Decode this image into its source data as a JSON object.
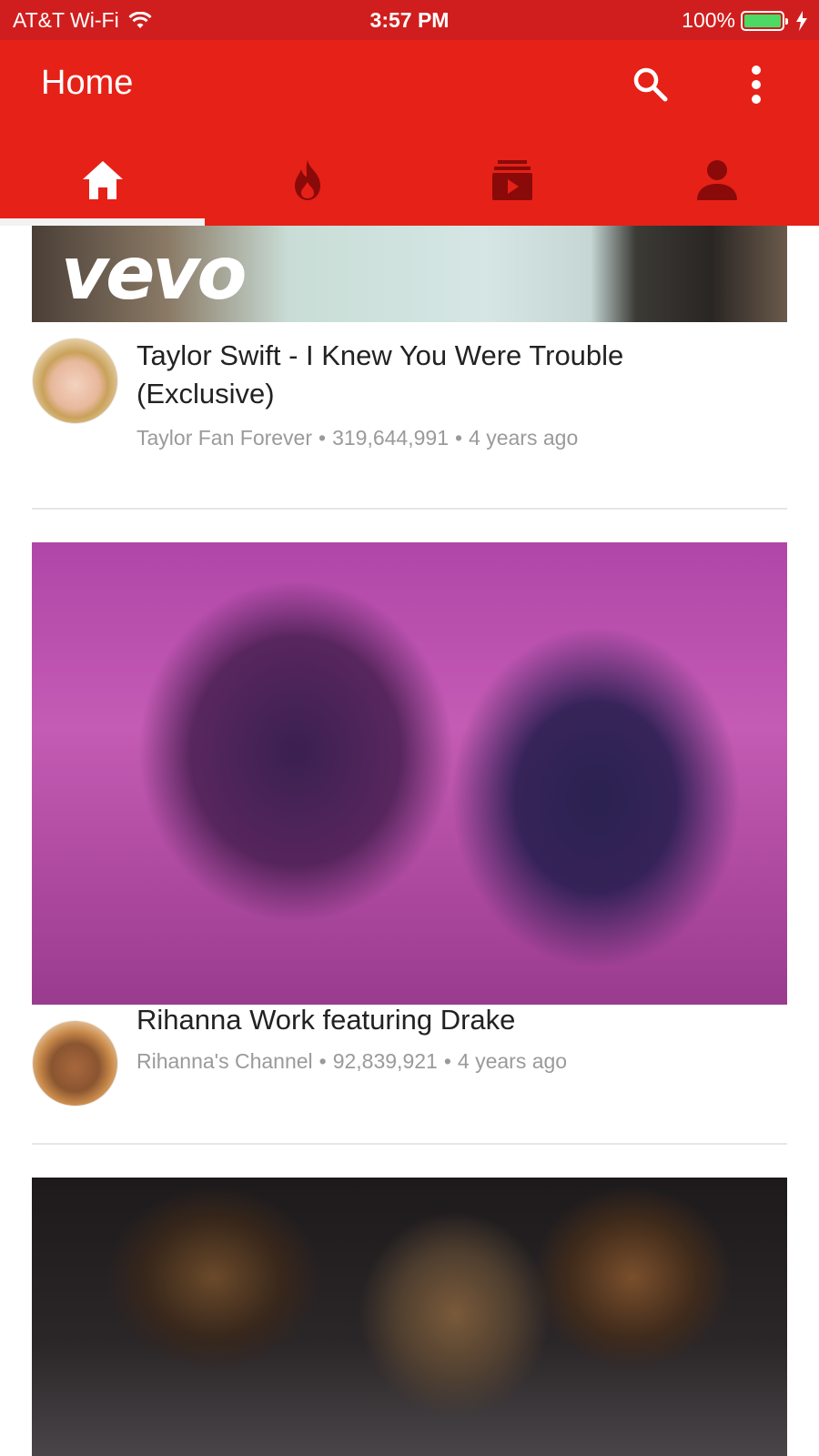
{
  "status_bar": {
    "carrier": "AT&T Wi-Fi",
    "time": "3:57 PM",
    "battery": "100%",
    "battery_level": 1.0,
    "battery_color": "#4cd964"
  },
  "app_bar": {
    "title": "Home",
    "color": "#e62117",
    "actions": [
      "search-icon",
      "more-vert-icon"
    ]
  },
  "tabs": [
    {
      "id": "home",
      "icon": "home-icon",
      "selected": true
    },
    {
      "id": "trending",
      "icon": "flame-icon",
      "selected": false
    },
    {
      "id": "subscriptions",
      "icon": "subscriptions-icon",
      "selected": false
    },
    {
      "id": "account",
      "icon": "person-icon",
      "selected": false
    }
  ],
  "videos": [
    {
      "title": "Taylor Swift - I Knew You Were Trouble (Exclusive)",
      "channel": "Taylor Fan Forever",
      "views": "319,644,991",
      "age": "4 years ago",
      "thumbnail_text": "vevo"
    },
    {
      "title": "Rihanna Work featuring Drake",
      "channel": "Rihanna's Channel",
      "views": "92,839,921",
      "age": "4 years ago"
    },
    {
      "title": "",
      "channel": "",
      "views": "",
      "age": ""
    }
  ]
}
